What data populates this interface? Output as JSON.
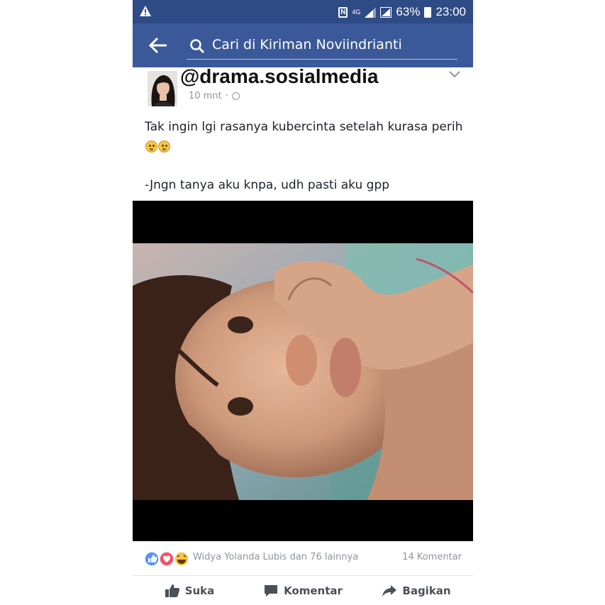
{
  "status_bar": {
    "battery_percent": "63%",
    "time": "23:00",
    "network": "4G",
    "icons": [
      "warning-icon",
      "nfc-icon",
      "signal-icon",
      "battery-icon"
    ]
  },
  "header": {
    "search_text": "Cari di Kiriman Noviindrianti",
    "icons": [
      "back-arrow-icon",
      "search-icon"
    ]
  },
  "post": {
    "watermark": "@drama.sosialmedia",
    "time": "10 mnt",
    "separator": "·",
    "text_line_1": "Tak ingin lgi rasanya kubercinta setelah kurasa perih",
    "text_line_2": "-Jngn tanya aku knpa, udh pasti aku gpp"
  },
  "reactions": {
    "names": "Widya Yolanda Lubis dan 76 lainnya",
    "comments_count": "14 Komentar",
    "reaction_icons": [
      "like-reaction-icon",
      "love-reaction-icon",
      "haha-reaction-icon"
    ]
  },
  "actions": {
    "like_label": "Suka",
    "comment_label": "Komentar",
    "share_label": "Bagikan"
  },
  "colors": {
    "status_bar": "#2f4b86",
    "header": "#3b5998",
    "photo_frame": "#000000"
  }
}
